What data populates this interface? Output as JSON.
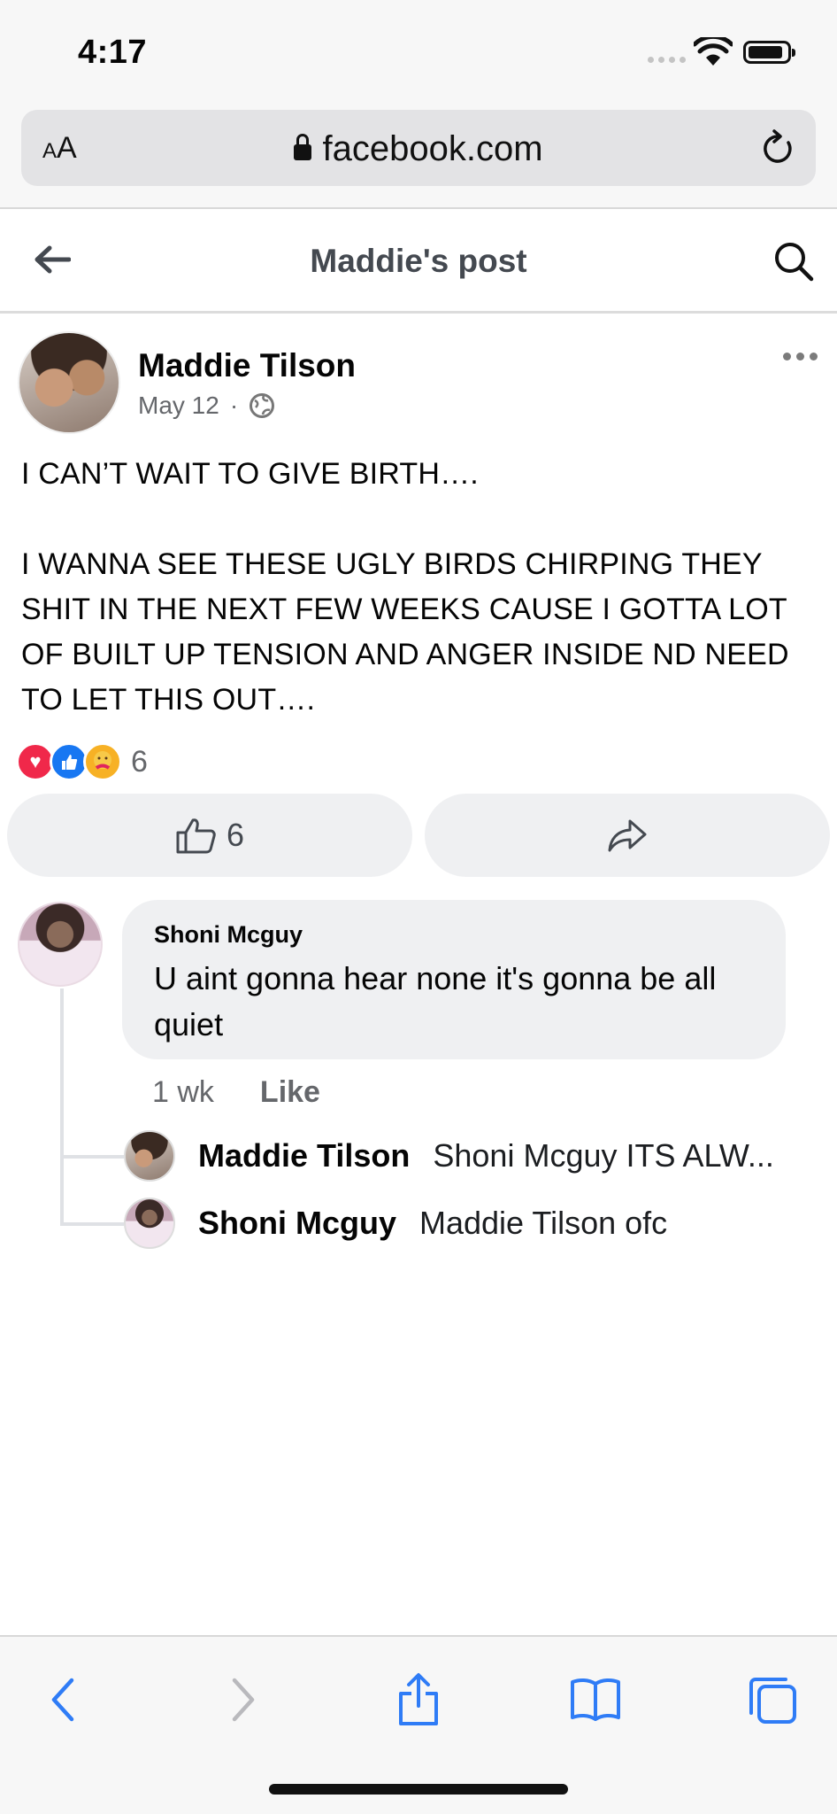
{
  "status_bar": {
    "time": "4:17"
  },
  "browser": {
    "text_size_label_small": "A",
    "text_size_label_large": "A",
    "url": "facebook.com"
  },
  "header": {
    "title": "Maddie's post"
  },
  "post": {
    "author": "Maddie Tilson",
    "date": "May 12",
    "separator": "·",
    "paragraphs": [
      "I CAN’T WAIT TO GIVE BIRTH….",
      "I WANNA SEE THESE UGLY BIRDS CHIRPING THEY SHIT IN THE NEXT FEW WEEKS CAUSE I GOTTA LOT OF BUILT UP TENSION AND ANGER INSIDE ND NEED TO LET THIS OUT…."
    ],
    "reaction_count": "6",
    "like_count": "6"
  },
  "comment": {
    "author": "Shoni Mcguy",
    "text": "U aint gonna hear none it's gonna be all quiet",
    "time": "1 wk",
    "like_label": "Like",
    "replies": [
      {
        "author": "Maddie Tilson",
        "text": "Shoni Mcguy ITS ALW..."
      },
      {
        "author": "Shoni Mcguy",
        "text": "Maddie Tilson ofc"
      }
    ]
  },
  "colors": {
    "facebook_blue": "#1877f2",
    "safari_blue": "#2f7cf6",
    "love_red": "#f0284a",
    "care_yellow": "#f7b125",
    "secondary_text": "#65676b"
  }
}
